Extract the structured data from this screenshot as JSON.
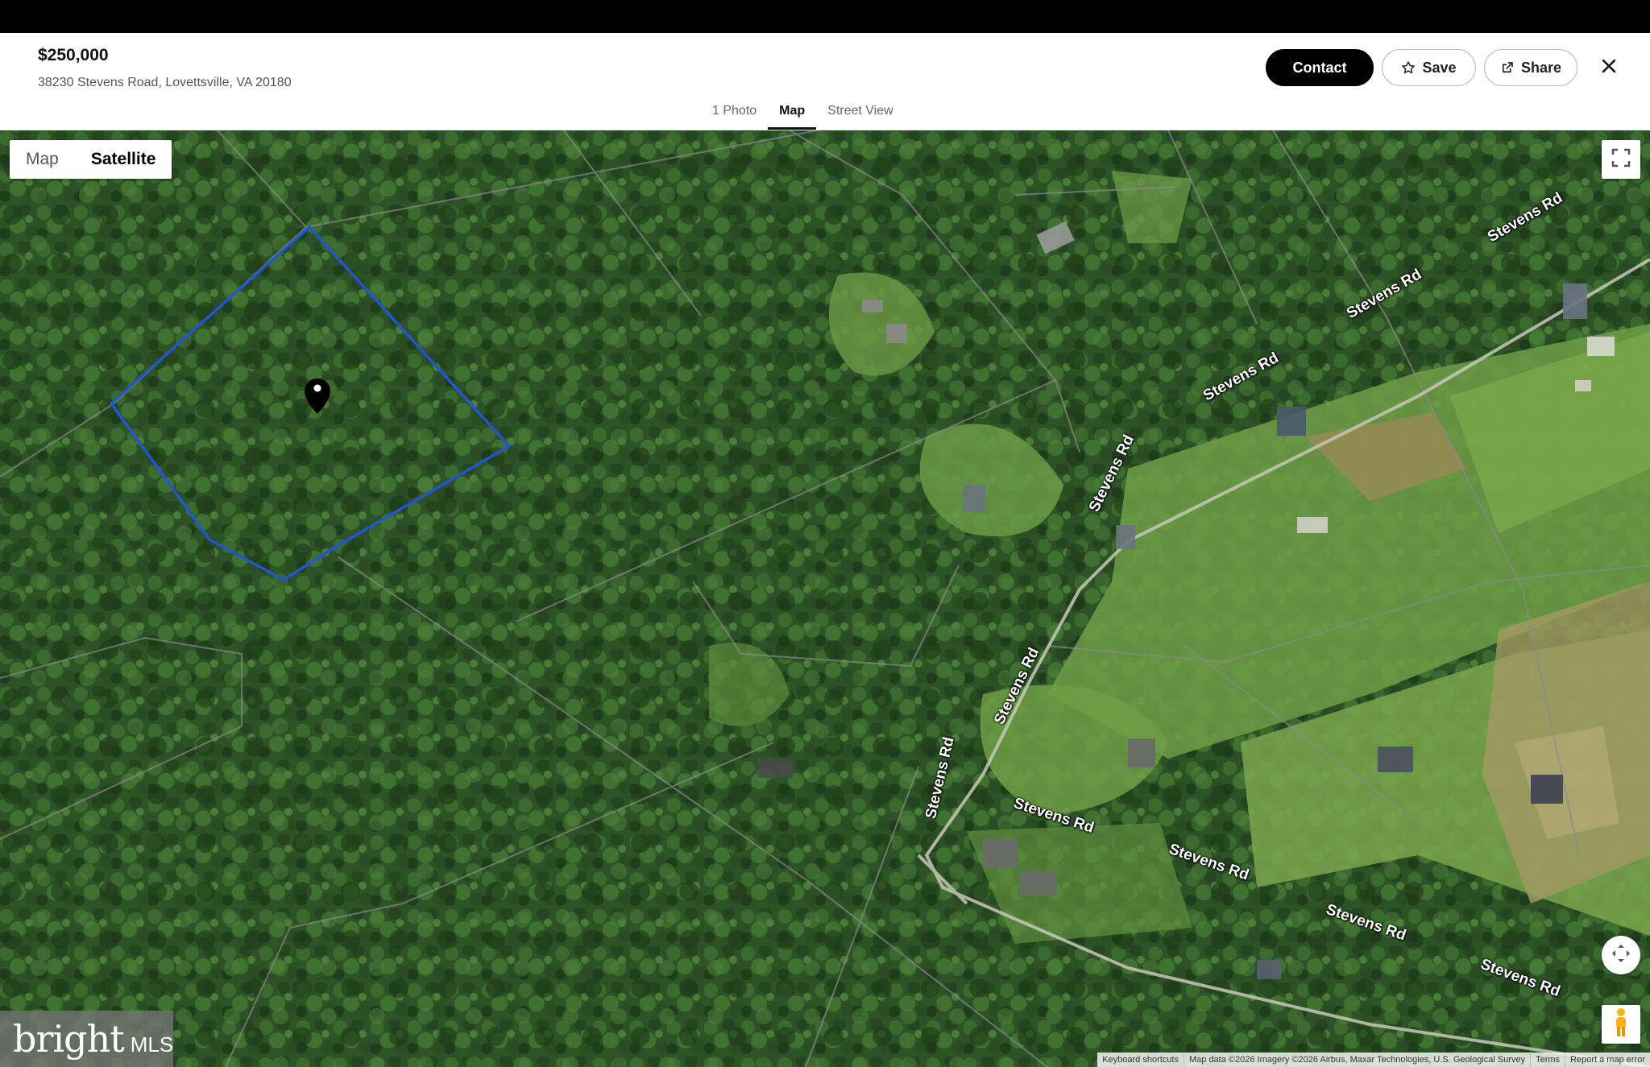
{
  "listing": {
    "price": "$250,000",
    "address": "38230 Stevens Road, Lovettsville, VA 20180"
  },
  "actions": {
    "contact": "Contact",
    "save": "Save",
    "share": "Share"
  },
  "tabs": [
    {
      "label": "1 Photo",
      "active": false
    },
    {
      "label": "Map",
      "active": true
    },
    {
      "label": "Street View",
      "active": false
    }
  ],
  "map": {
    "type_toggle": {
      "map": "Map",
      "satellite": "Satellite",
      "selected": "Satellite"
    },
    "road_labels": [
      "Stevens Rd",
      "Stevens Rd",
      "Stevens Rd",
      "Stevens Rd",
      "Stevens Rd",
      "Stevens Rd",
      "Stevens Rd",
      "Stevens Rd",
      "Stevens Rd",
      "Stevens Rd"
    ],
    "attribution": {
      "shortcuts": "Keyboard shortcuts",
      "data": "Map data ©2026 Imagery ©2026 Airbus, Maxar Technologies, U.S. Geological Survey",
      "terms": "Terms",
      "report": "Report a map error"
    },
    "boundary_color": "#2255d0"
  },
  "branding": {
    "logo": "bright",
    "logo_suffix": "MLS"
  }
}
